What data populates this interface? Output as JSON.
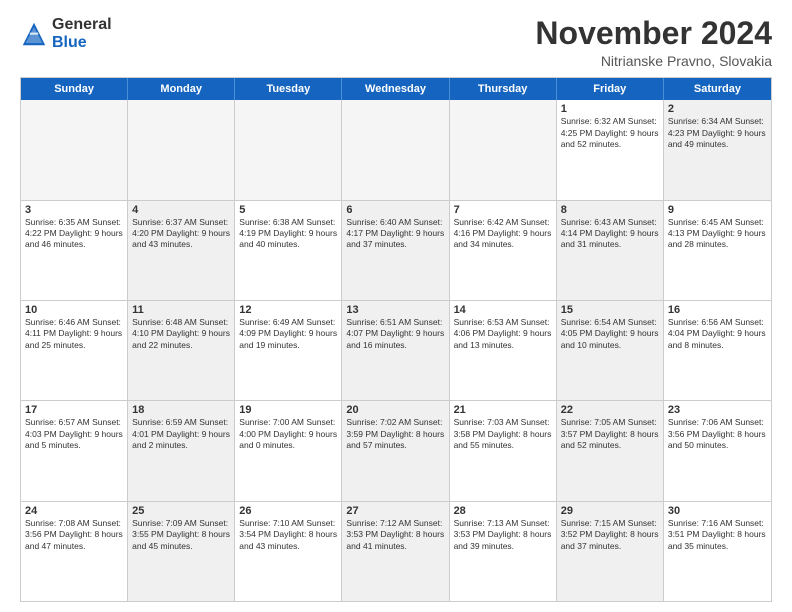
{
  "header": {
    "logo_general": "General",
    "logo_blue": "Blue",
    "month_title": "November 2024",
    "location": "Nitrianske Pravno, Slovakia"
  },
  "weekdays": [
    "Sunday",
    "Monday",
    "Tuesday",
    "Wednesday",
    "Thursday",
    "Friday",
    "Saturday"
  ],
  "rows": [
    {
      "cells": [
        {
          "day": "",
          "info": "",
          "empty": true
        },
        {
          "day": "",
          "info": "",
          "empty": true
        },
        {
          "day": "",
          "info": "",
          "empty": true
        },
        {
          "day": "",
          "info": "",
          "empty": true
        },
        {
          "day": "",
          "info": "",
          "empty": true
        },
        {
          "day": "1",
          "info": "Sunrise: 6:32 AM\nSunset: 4:25 PM\nDaylight: 9 hours\nand 52 minutes.",
          "empty": false
        },
        {
          "day": "2",
          "info": "Sunrise: 6:34 AM\nSunset: 4:23 PM\nDaylight: 9 hours\nand 49 minutes.",
          "empty": false,
          "shaded": true
        }
      ]
    },
    {
      "cells": [
        {
          "day": "3",
          "info": "Sunrise: 6:35 AM\nSunset: 4:22 PM\nDaylight: 9 hours\nand 46 minutes.",
          "empty": false
        },
        {
          "day": "4",
          "info": "Sunrise: 6:37 AM\nSunset: 4:20 PM\nDaylight: 9 hours\nand 43 minutes.",
          "empty": false,
          "shaded": true
        },
        {
          "day": "5",
          "info": "Sunrise: 6:38 AM\nSunset: 4:19 PM\nDaylight: 9 hours\nand 40 minutes.",
          "empty": false
        },
        {
          "day": "6",
          "info": "Sunrise: 6:40 AM\nSunset: 4:17 PM\nDaylight: 9 hours\nand 37 minutes.",
          "empty": false,
          "shaded": true
        },
        {
          "day": "7",
          "info": "Sunrise: 6:42 AM\nSunset: 4:16 PM\nDaylight: 9 hours\nand 34 minutes.",
          "empty": false
        },
        {
          "day": "8",
          "info": "Sunrise: 6:43 AM\nSunset: 4:14 PM\nDaylight: 9 hours\nand 31 minutes.",
          "empty": false,
          "shaded": true
        },
        {
          "day": "9",
          "info": "Sunrise: 6:45 AM\nSunset: 4:13 PM\nDaylight: 9 hours\nand 28 minutes.",
          "empty": false
        }
      ]
    },
    {
      "cells": [
        {
          "day": "10",
          "info": "Sunrise: 6:46 AM\nSunset: 4:11 PM\nDaylight: 9 hours\nand 25 minutes.",
          "empty": false
        },
        {
          "day": "11",
          "info": "Sunrise: 6:48 AM\nSunset: 4:10 PM\nDaylight: 9 hours\nand 22 minutes.",
          "empty": false,
          "shaded": true
        },
        {
          "day": "12",
          "info": "Sunrise: 6:49 AM\nSunset: 4:09 PM\nDaylight: 9 hours\nand 19 minutes.",
          "empty": false
        },
        {
          "day": "13",
          "info": "Sunrise: 6:51 AM\nSunset: 4:07 PM\nDaylight: 9 hours\nand 16 minutes.",
          "empty": false,
          "shaded": true
        },
        {
          "day": "14",
          "info": "Sunrise: 6:53 AM\nSunset: 4:06 PM\nDaylight: 9 hours\nand 13 minutes.",
          "empty": false
        },
        {
          "day": "15",
          "info": "Sunrise: 6:54 AM\nSunset: 4:05 PM\nDaylight: 9 hours\nand 10 minutes.",
          "empty": false,
          "shaded": true
        },
        {
          "day": "16",
          "info": "Sunrise: 6:56 AM\nSunset: 4:04 PM\nDaylight: 9 hours\nand 8 minutes.",
          "empty": false
        }
      ]
    },
    {
      "cells": [
        {
          "day": "17",
          "info": "Sunrise: 6:57 AM\nSunset: 4:03 PM\nDaylight: 9 hours\nand 5 minutes.",
          "empty": false
        },
        {
          "day": "18",
          "info": "Sunrise: 6:59 AM\nSunset: 4:01 PM\nDaylight: 9 hours\nand 2 minutes.",
          "empty": false,
          "shaded": true
        },
        {
          "day": "19",
          "info": "Sunrise: 7:00 AM\nSunset: 4:00 PM\nDaylight: 9 hours\nand 0 minutes.",
          "empty": false
        },
        {
          "day": "20",
          "info": "Sunrise: 7:02 AM\nSunset: 3:59 PM\nDaylight: 8 hours\nand 57 minutes.",
          "empty": false,
          "shaded": true
        },
        {
          "day": "21",
          "info": "Sunrise: 7:03 AM\nSunset: 3:58 PM\nDaylight: 8 hours\nand 55 minutes.",
          "empty": false
        },
        {
          "day": "22",
          "info": "Sunrise: 7:05 AM\nSunset: 3:57 PM\nDaylight: 8 hours\nand 52 minutes.",
          "empty": false,
          "shaded": true
        },
        {
          "day": "23",
          "info": "Sunrise: 7:06 AM\nSunset: 3:56 PM\nDaylight: 8 hours\nand 50 minutes.",
          "empty": false
        }
      ]
    },
    {
      "cells": [
        {
          "day": "24",
          "info": "Sunrise: 7:08 AM\nSunset: 3:56 PM\nDaylight: 8 hours\nand 47 minutes.",
          "empty": false
        },
        {
          "day": "25",
          "info": "Sunrise: 7:09 AM\nSunset: 3:55 PM\nDaylight: 8 hours\nand 45 minutes.",
          "empty": false,
          "shaded": true
        },
        {
          "day": "26",
          "info": "Sunrise: 7:10 AM\nSunset: 3:54 PM\nDaylight: 8 hours\nand 43 minutes.",
          "empty": false
        },
        {
          "day": "27",
          "info": "Sunrise: 7:12 AM\nSunset: 3:53 PM\nDaylight: 8 hours\nand 41 minutes.",
          "empty": false,
          "shaded": true
        },
        {
          "day": "28",
          "info": "Sunrise: 7:13 AM\nSunset: 3:53 PM\nDaylight: 8 hours\nand 39 minutes.",
          "empty": false
        },
        {
          "day": "29",
          "info": "Sunrise: 7:15 AM\nSunset: 3:52 PM\nDaylight: 8 hours\nand 37 minutes.",
          "empty": false,
          "shaded": true
        },
        {
          "day": "30",
          "info": "Sunrise: 7:16 AM\nSunset: 3:51 PM\nDaylight: 8 hours\nand 35 minutes.",
          "empty": false
        }
      ]
    }
  ]
}
